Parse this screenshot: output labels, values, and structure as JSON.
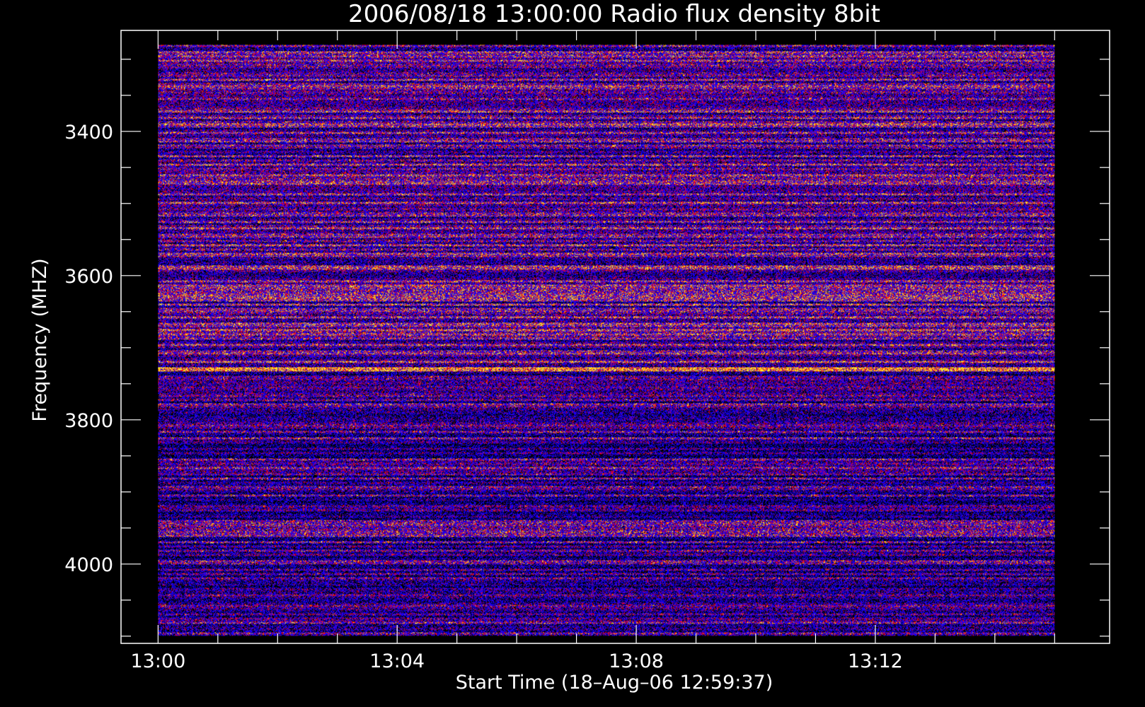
{
  "chart_data": {
    "type": "heatmap",
    "title": "2006/08/18 13:00:00 Radio flux density 8bit",
    "xlabel": "Start Time (18–Aug–06 12:59:37)",
    "ylabel": "Frequency (MHZ)",
    "x_range_minutes": [
      -0.62,
      15.92
    ],
    "data_x_range_minutes": [
      0.0,
      15.0
    ],
    "y_range_mhz": [
      3260,
      4110
    ],
    "data_y_range_mhz": [
      3280,
      4100
    ],
    "y_inverted": true,
    "x_ticks": [
      {
        "value": 0,
        "label": "13:00"
      },
      {
        "value": 4,
        "label": "13:04"
      },
      {
        "value": 8,
        "label": "13:08"
      },
      {
        "value": 12,
        "label": "13:12"
      }
    ],
    "x_minor_step_minutes": 1,
    "y_ticks": [
      {
        "value": 3400,
        "label": "3400"
      },
      {
        "value": 3600,
        "label": "3600"
      },
      {
        "value": 3800,
        "label": "3800"
      },
      {
        "value": 4000,
        "label": "4000"
      }
    ],
    "y_minor_step_mhz": 50,
    "colorscale": [
      "#000000",
      "#0000ff",
      "#ff0000",
      "#ffff00"
    ],
    "bright_band_mhz": 3730,
    "grid": false,
    "legend": "none"
  }
}
